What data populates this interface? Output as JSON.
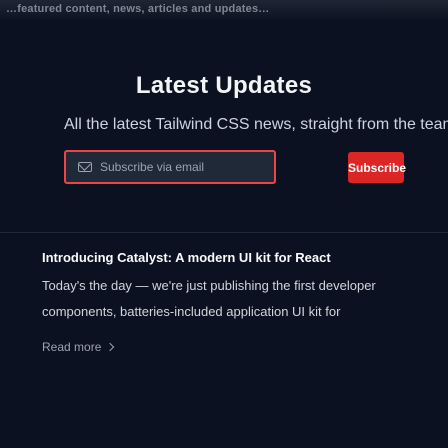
{
  "header": {
    "top_text": "…featured content, news, articles and updates…"
  },
  "updates_section": {
    "title": "Latest Updates",
    "subtitle": "All the latest Tailwind CSS news, straight from the team."
  },
  "newsletter": {
    "placeholder": "Subscribe via email",
    "subscribe_label": "Subscribe"
  },
  "article": {
    "title": "Introducing Catalyst: A modern UI kit for React",
    "excerpt_line1": "Today's the day — we're just publishing the first developer",
    "excerpt_line2": "components, batteries-included application UI kit for",
    "read_more": "Read more"
  },
  "icons": {
    "email_icon": "mail-icon",
    "read_more_icon": "chevron-right-icon"
  },
  "colors": {
    "background": "#0b1120",
    "accent": "#dc2626",
    "text": "#e5e7eb"
  }
}
